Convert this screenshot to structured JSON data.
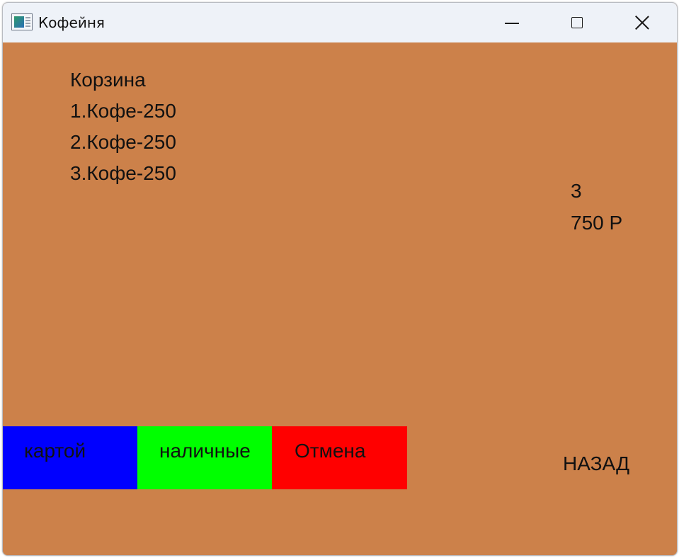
{
  "window": {
    "title": "Кофейня",
    "icon": "app-window-icon",
    "controls": {
      "minimize": "minimize-icon",
      "maximize": "maximize-icon",
      "close": "close-icon"
    }
  },
  "cart": {
    "title": "Корзина",
    "items": [
      {
        "label": "1.Кофе-250"
      },
      {
        "label": "2.Кофе-250"
      },
      {
        "label": "3.Кофе-250"
      }
    ],
    "count": "3",
    "total": "750 Р"
  },
  "buttons": {
    "card": {
      "label": "картой",
      "color": "#0000ff"
    },
    "cash": {
      "label": "наличные",
      "color": "#00ff00"
    },
    "cancel": {
      "label": "Отмена",
      "color": "#ff0000"
    },
    "back": {
      "label": "НАЗАД"
    }
  },
  "colors": {
    "background": "#cc814a",
    "titlebar": "#eef2f8"
  }
}
